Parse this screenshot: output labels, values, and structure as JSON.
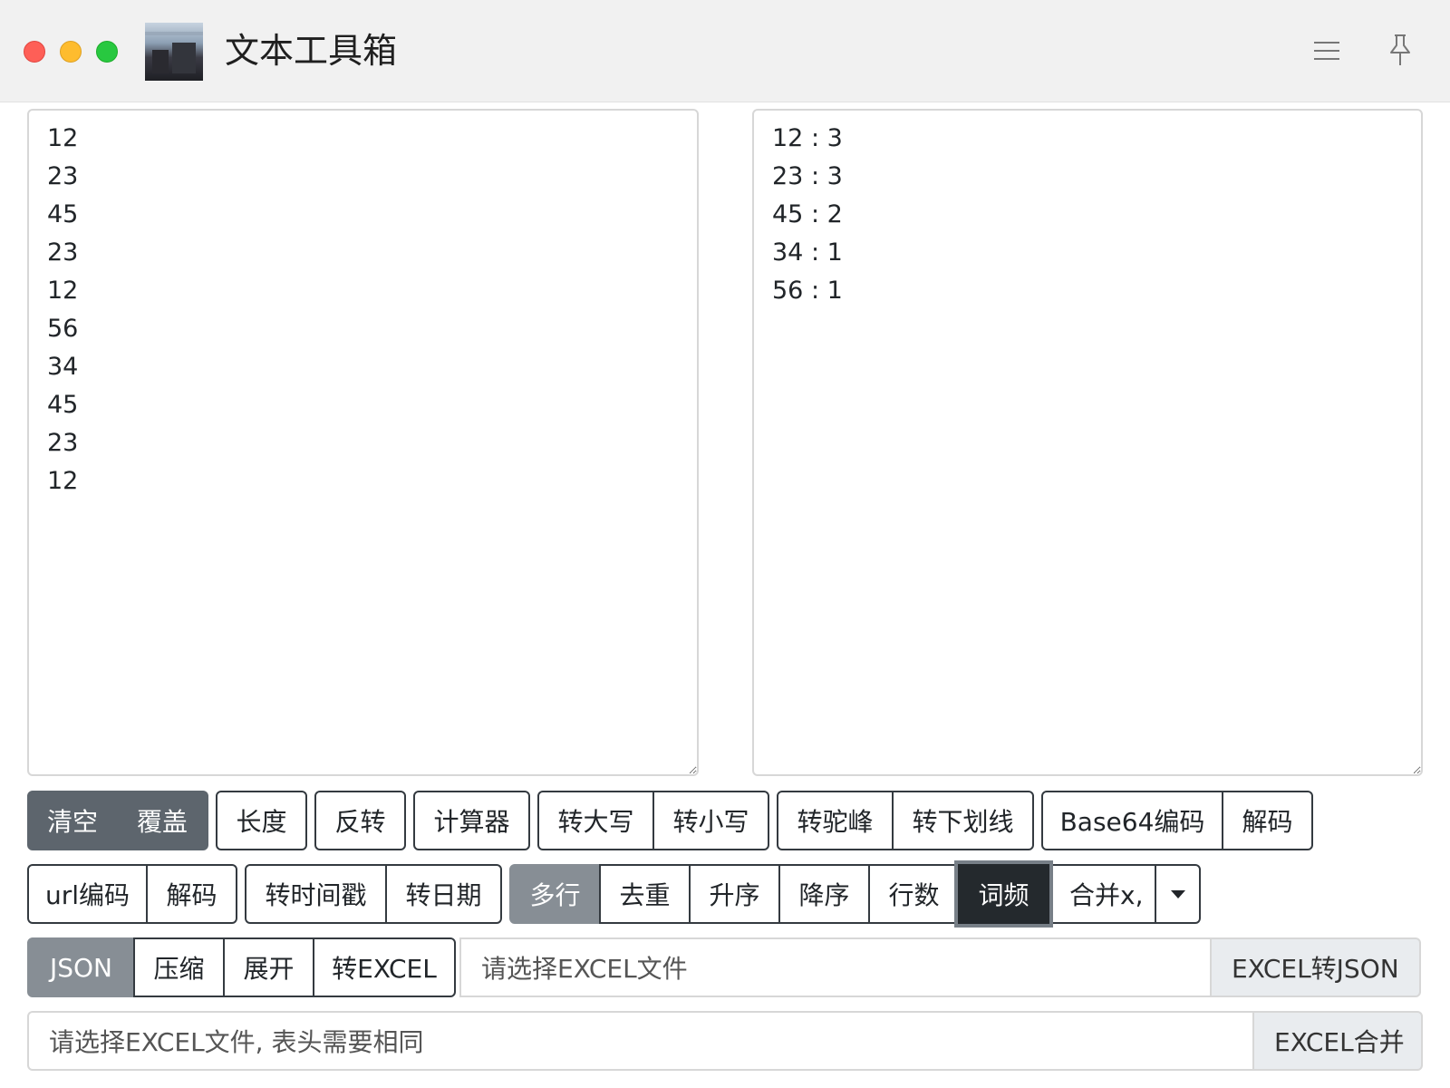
{
  "window": {
    "title": "文本工具箱"
  },
  "editor": {
    "input_text": "12\n23\n45\n23\n12\n56\n34\n45\n23\n12",
    "output_text": "12 : 3\n23 : 3\n45 : 2\n34 : 1\n56 : 1"
  },
  "row1": {
    "clear": "清空",
    "overwrite": "覆盖",
    "length": "长度",
    "reverse": "反转",
    "calculator": "计算器",
    "upper": "转大写",
    "lower": "转小写",
    "camel": "转驼峰",
    "underscore": "转下划线",
    "base64": "Base64编码",
    "decode": "解码"
  },
  "row2": {
    "url_encode": "url编码",
    "url_decode": "解码",
    "to_timestamp": "转时间戳",
    "to_date": "转日期",
    "multiline": "多行",
    "dedupe": "去重",
    "asc": "升序",
    "desc": "降序",
    "line_count": "行数",
    "word_freq": "词频",
    "merge": "合并x,"
  },
  "row3": {
    "json": "JSON",
    "compress": "压缩",
    "expand": "展开",
    "to_excel": "转EXCEL",
    "file_placeholder": "请选择EXCEL文件",
    "excel_to_json": "EXCEL转JSON"
  },
  "row4": {
    "file_placeholder": "请选择EXCEL文件, 表头需要相同",
    "excel_merge": "EXCEL合并"
  },
  "icons": {
    "menu": "hamburger-icon",
    "pin": "pin-icon",
    "app": "app-logo"
  },
  "colors": {
    "dark_btn": "#5d656d",
    "gray_btn": "#878e95",
    "active_btn": "#24292d"
  }
}
